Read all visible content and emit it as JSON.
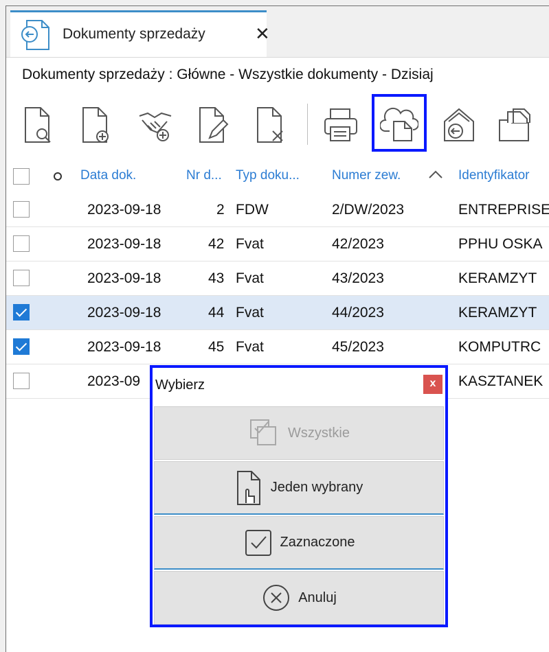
{
  "tab": {
    "label": "Dokumenty sprzedaży",
    "close": "✕"
  },
  "breadcrumb": "Dokumenty sprzedaży : Główne - Wszystkie dokumenty - Dzisiaj",
  "toolbar": {
    "buttons": [
      {
        "icon": "document-preview-icon"
      },
      {
        "icon": "document-add-icon"
      },
      {
        "icon": "handshake-add-icon"
      },
      {
        "icon": "document-edit-icon"
      },
      {
        "icon": "document-delete-icon"
      },
      {
        "icon": "printer-icon"
      },
      {
        "icon": "cloud-document-icon",
        "highlighted": true
      },
      {
        "icon": "house-import-icon"
      },
      {
        "icon": "folder-documents-icon"
      }
    ],
    "accent_color": "#0a19ff"
  },
  "table": {
    "columns": [
      "Data dok.",
      "Nr d...",
      "Typ doku...",
      "Numer zew.",
      "Identyfikator"
    ],
    "rows": [
      {
        "checked": false,
        "date": "2023-09-18",
        "nr": "2",
        "type": "FDW",
        "ext": "2/DW/2023",
        "ident": "ENTREPRISE"
      },
      {
        "checked": false,
        "date": "2023-09-18",
        "nr": "42",
        "type": "Fvat",
        "ext": "42/2023",
        "ident": "PPHU OSKA"
      },
      {
        "checked": false,
        "date": "2023-09-18",
        "nr": "43",
        "type": "Fvat",
        "ext": "43/2023",
        "ident": "KERAMZYT"
      },
      {
        "checked": true,
        "date": "2023-09-18",
        "nr": "44",
        "type": "Fvat",
        "ext": "44/2023",
        "ident": "KERAMZYT"
      },
      {
        "checked": true,
        "date": "2023-09-18",
        "nr": "45",
        "type": "Fvat",
        "ext": "45/2023",
        "ident": "KOMPUTRC"
      },
      {
        "checked": false,
        "date": "2023-09",
        "nr": "",
        "type": "",
        "ext": "",
        "ident": "KASZTANEK"
      }
    ]
  },
  "dialog": {
    "title": "Wybierz",
    "close": "x",
    "buttons": {
      "all": "Wszystkie",
      "one": "Jeden wybrany",
      "marked": "Zaznaczone",
      "cancel": "Anuluj"
    }
  }
}
